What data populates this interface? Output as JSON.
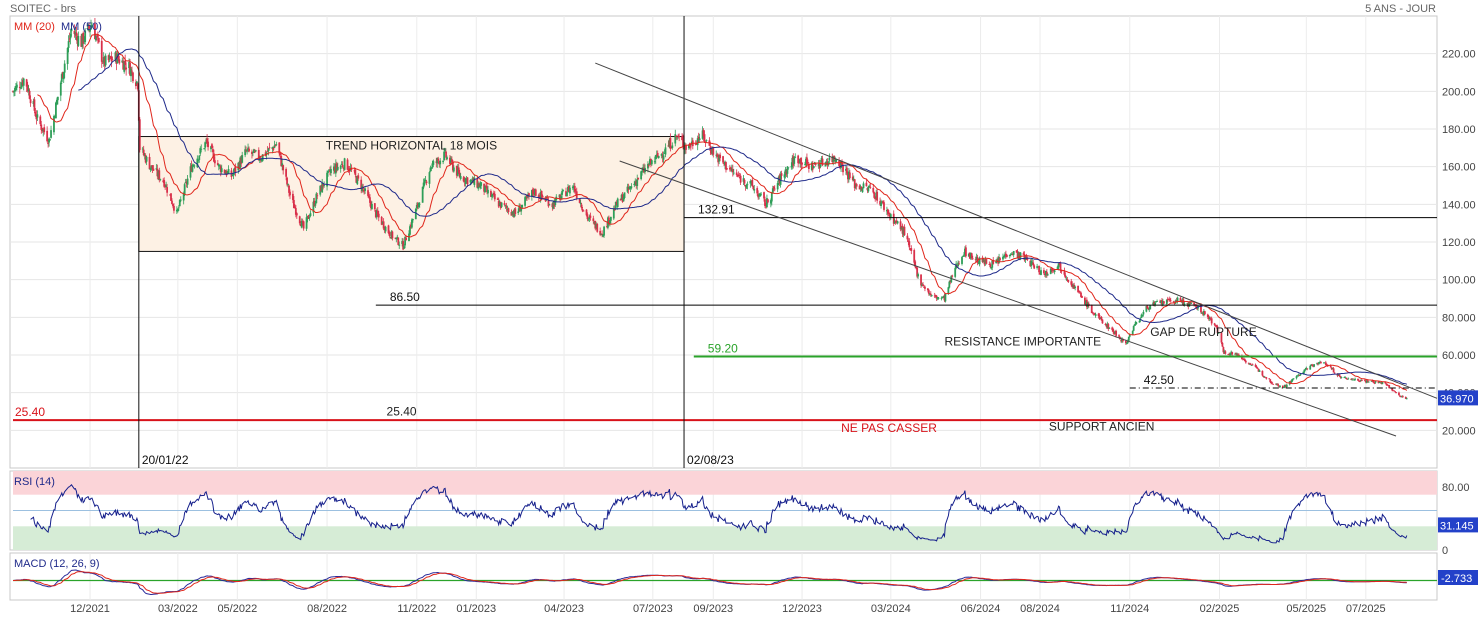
{
  "header": {
    "title": "SOITEC - brs",
    "period": "5 ANS - JOUR"
  },
  "colors": {
    "up": "#2e9e58",
    "down": "#d9304a",
    "ma20": "#e0261b",
    "ma50": "#1f2a8a",
    "support": "#d8121a",
    "resistance": "#2aa32a",
    "price_tag": "#2341c9",
    "rsi_line": "#16208c",
    "macd_line": "#2a2a9a",
    "signal_line": "#e0261b",
    "histogram": "#2aa32a"
  },
  "chart_data": [
    {
      "type": "candlestick",
      "title": "SOITEC - brs",
      "x_range": [
        "2021-09-13",
        "2025-09-12"
      ],
      "ylim": [
        0,
        240
      ],
      "yticks": [
        20,
        40,
        60,
        80,
        100,
        120,
        140,
        160,
        180,
        200,
        220
      ],
      "ytick_labels": [
        "20.000",
        "40.000",
        "60.000",
        "80.000",
        "100.00",
        "120.00",
        "140.00",
        "160.00",
        "180.00",
        "200.00",
        "220.00"
      ],
      "xtick_labels": [
        "12/2021",
        "03/2022",
        "05/2022",
        "08/2022",
        "11/2022",
        "01/2023",
        "04/2023",
        "07/2023",
        "09/2023",
        "12/2023",
        "03/2024",
        "06/2024",
        "08/2024",
        "11/2024",
        "02/2025",
        "05/2025",
        "07/2025"
      ],
      "xtick_dates": [
        "2021-12-01",
        "2022-03-01",
        "2022-05-01",
        "2022-08-01",
        "2022-11-01",
        "2023-01-01",
        "2023-04-01",
        "2023-07-01",
        "2023-09-01",
        "2023-12-01",
        "2024-03-01",
        "2024-06-01",
        "2024-08-01",
        "2024-11-01",
        "2025-02-01",
        "2025-05-01",
        "2025-07-01"
      ],
      "grid": true,
      "legend": [
        {
          "name": "MM (20)",
          "color": "#e0261b"
        },
        {
          "name": "MM (50)",
          "color": "#1f2a8a"
        }
      ],
      "last_price": "36.970",
      "price_path": [
        [
          "2021-09-13",
          200
        ],
        [
          "2021-09-25",
          207
        ],
        [
          "2021-10-08",
          185
        ],
        [
          "2021-10-20",
          174
        ],
        [
          "2021-11-01",
          205
        ],
        [
          "2021-11-12",
          233
        ],
        [
          "2021-11-22",
          226
        ],
        [
          "2021-12-03",
          236
        ],
        [
          "2021-12-15",
          215
        ],
        [
          "2021-12-28",
          218
        ],
        [
          "2022-01-10",
          213
        ],
        [
          "2022-01-19",
          204
        ],
        [
          "2022-01-21",
          170
        ],
        [
          "2022-02-01",
          160
        ],
        [
          "2022-02-15",
          152
        ],
        [
          "2022-02-28",
          135
        ],
        [
          "2022-03-15",
          160
        ],
        [
          "2022-03-30",
          173
        ],
        [
          "2022-04-12",
          160
        ],
        [
          "2022-04-25",
          155
        ],
        [
          "2022-05-10",
          168
        ],
        [
          "2022-05-25",
          165
        ],
        [
          "2022-06-10",
          172
        ],
        [
          "2022-06-25",
          143
        ],
        [
          "2022-07-08",
          127
        ],
        [
          "2022-07-22",
          145
        ],
        [
          "2022-08-05",
          158
        ],
        [
          "2022-08-20",
          162
        ],
        [
          "2022-09-05",
          150
        ],
        [
          "2022-09-20",
          135
        ],
        [
          "2022-10-05",
          124
        ],
        [
          "2022-10-18",
          118
        ],
        [
          "2022-11-01",
          138
        ],
        [
          "2022-11-15",
          160
        ],
        [
          "2022-11-30",
          166
        ],
        [
          "2022-12-15",
          155
        ],
        [
          "2023-01-05",
          150
        ],
        [
          "2023-01-25",
          140
        ],
        [
          "2023-02-10",
          135
        ],
        [
          "2023-03-01",
          147
        ],
        [
          "2023-03-20",
          140
        ],
        [
          "2023-04-10",
          150
        ],
        [
          "2023-04-25",
          133
        ],
        [
          "2023-05-10",
          125
        ],
        [
          "2023-05-25",
          140
        ],
        [
          "2023-06-10",
          150
        ],
        [
          "2023-06-25",
          160
        ],
        [
          "2023-07-12",
          168
        ],
        [
          "2023-07-25",
          176
        ],
        [
          "2023-08-05",
          170
        ],
        [
          "2023-08-20",
          177
        ],
        [
          "2023-09-05",
          165
        ],
        [
          "2023-09-25",
          155
        ],
        [
          "2023-10-10",
          150
        ],
        [
          "2023-10-25",
          140
        ],
        [
          "2023-11-10",
          155
        ],
        [
          "2023-11-25",
          165
        ],
        [
          "2023-12-10",
          160
        ],
        [
          "2024-01-05",
          165
        ],
        [
          "2024-01-25",
          150
        ],
        [
          "2024-02-10",
          148
        ],
        [
          "2024-02-28",
          135
        ],
        [
          "2024-03-15",
          125
        ],
        [
          "2024-03-30",
          100
        ],
        [
          "2024-04-12",
          91
        ],
        [
          "2024-04-25",
          90
        ],
        [
          "2024-05-05",
          105
        ],
        [
          "2024-05-15",
          115
        ],
        [
          "2024-05-30",
          110
        ],
        [
          "2024-06-15",
          108
        ],
        [
          "2024-07-01",
          115
        ],
        [
          "2024-07-15",
          112
        ],
        [
          "2024-08-05",
          103
        ],
        [
          "2024-08-20",
          108
        ],
        [
          "2024-09-05",
          96
        ],
        [
          "2024-09-25",
          82
        ],
        [
          "2024-10-10",
          75
        ],
        [
          "2024-10-28",
          66
        ],
        [
          "2024-11-05",
          75
        ],
        [
          "2024-11-20",
          86
        ],
        [
          "2024-12-05",
          88
        ],
        [
          "2024-12-20",
          89
        ],
        [
          "2025-01-10",
          85
        ],
        [
          "2025-01-28",
          76
        ],
        [
          "2025-02-05",
          62
        ],
        [
          "2025-02-20",
          60
        ],
        [
          "2025-03-10",
          53
        ],
        [
          "2025-03-28",
          45
        ],
        [
          "2025-04-08",
          43
        ],
        [
          "2025-04-22",
          49
        ],
        [
          "2025-05-08",
          55
        ],
        [
          "2025-05-20",
          56
        ],
        [
          "2025-06-05",
          48
        ],
        [
          "2025-06-20",
          47
        ],
        [
          "2025-07-05",
          46
        ],
        [
          "2025-07-20",
          45
        ],
        [
          "2025-08-05",
          38
        ],
        [
          "2025-08-12",
          36.97
        ]
      ],
      "horizontal_lines": [
        {
          "value": 132.91,
          "label": "132.91",
          "color": "#000000",
          "from": "2023-08-02"
        },
        {
          "value": 86.5,
          "label": "86.50",
          "color": "#000000",
          "from": "2022-09-20"
        },
        {
          "value": 59.2,
          "label": "59.20",
          "color": "#2aa32a",
          "from": "2023-08-12"
        },
        {
          "value": 42.5,
          "label": "42.50",
          "color": "#000000",
          "from": "2024-11-01",
          "dashed": true
        },
        {
          "value": 25.4,
          "label": "25.40",
          "color": "#d8121a",
          "from": "2021-09-13"
        }
      ],
      "vertical_lines": [
        {
          "date": "2022-01-20",
          "label": "20/01/22"
        },
        {
          "date": "2023-08-02",
          "label": "02/08/23"
        }
      ],
      "box": {
        "from": "2022-01-20",
        "to": "2023-08-02",
        "low": 115,
        "high": 176,
        "label": "TREND HORIZONTAL  18 MOIS"
      },
      "trend_lines": [
        {
          "from": [
            "2023-05-03",
            215
          ],
          "to": [
            "2025-09-12",
            37
          ]
        },
        {
          "from": [
            "2023-05-28",
            163
          ],
          "to": [
            "2025-08-01",
            17
          ]
        }
      ],
      "annotations": [
        {
          "text": "25.40",
          "date": "2022-10-01",
          "value": 28,
          "color": "#222222"
        },
        {
          "text": "RESISTANCE IMPORTANTE",
          "date": "2024-04-25",
          "value": 65,
          "color": "#222222"
        },
        {
          "text": "GAP DE RUPTURE",
          "date": "2024-11-22",
          "value": 70,
          "color": "#222222"
        },
        {
          "text": "NE PAS CASSER",
          "date": "2024-01-10",
          "value": 19,
          "color": "#d8121a"
        },
        {
          "text": "SUPPORT ANCIEN",
          "date": "2024-08-10",
          "value": 20,
          "color": "#222222"
        }
      ]
    },
    {
      "type": "line",
      "title": "RSI (14)",
      "ylim": [
        0,
        100
      ],
      "yticks": [
        0,
        80
      ],
      "ytick_labels": [
        "0",
        "80.00"
      ],
      "overbought": 70,
      "oversold": 30,
      "last_value": "31.145"
    },
    {
      "type": "line",
      "title": "MACD (12, 26, 9)",
      "last_value": "-2.733"
    }
  ]
}
